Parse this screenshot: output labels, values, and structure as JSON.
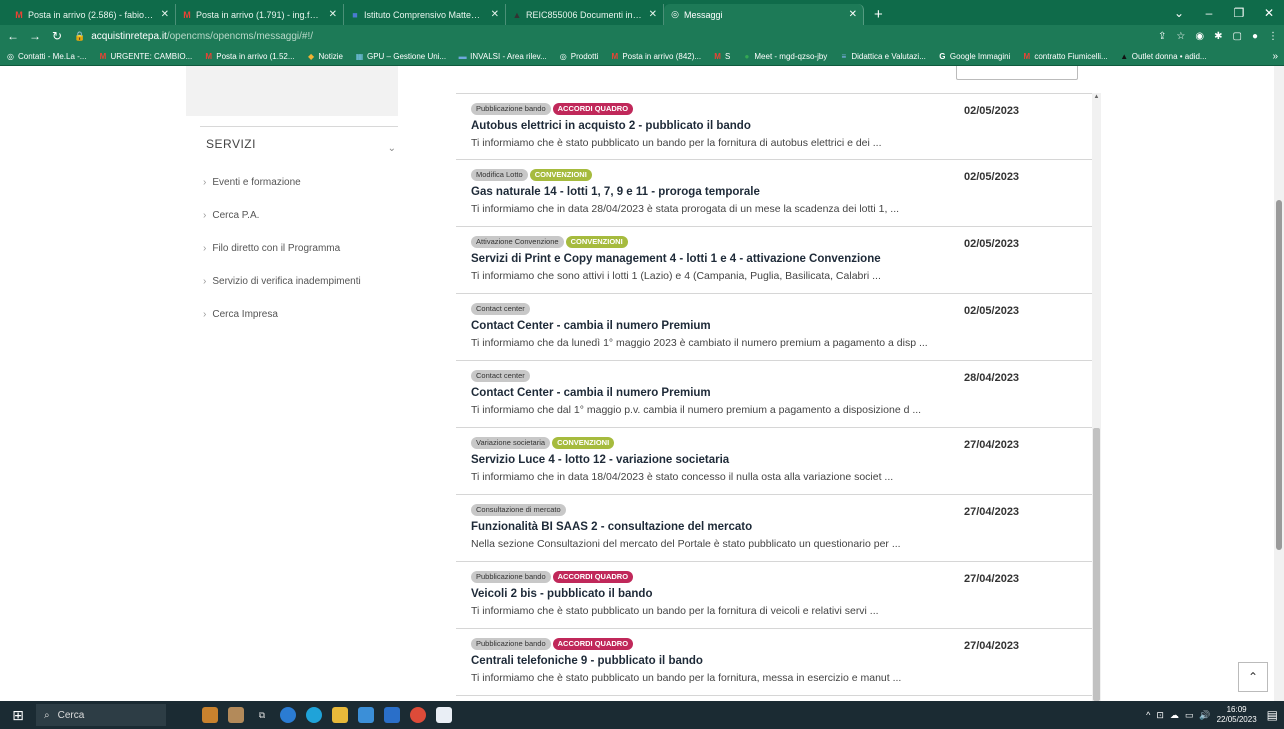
{
  "browser": {
    "tabs": [
      {
        "title": "Posta in arrivo (2.586) - fabio.ber",
        "icon": "gmail-icon",
        "active": false
      },
      {
        "title": "Posta in arrivo (1.791) - ing.fabio.",
        "icon": "gmail-icon",
        "active": false
      },
      {
        "title": "Istituto Comprensivo Matteo Ma",
        "icon": "school-icon",
        "active": false
      },
      {
        "title": "REIC855006 Documenti in DA Sh",
        "icon": "drive-icon",
        "active": false
      },
      {
        "title": "Messaggi",
        "icon": "site-icon",
        "active": true
      }
    ],
    "new_tab": "+",
    "url_host": "acquistinretepa.it",
    "url_path": "/opencms/opencms/messaggi/#!/",
    "bookmarks": [
      "Contatti - Me.La -...",
      "URGENTE: CAMBIO...",
      "Posta in arrivo (1.52...",
      "Notizie",
      "GPU – Gestione Uni...",
      "INVALSI - Area rilev...",
      "Prodotti",
      "Posta in arrivo (842)...",
      "S",
      "Meet - mgd-qzso-jby",
      "Didattica e Valutazi...",
      "Google Immagini",
      "contratto Fiumicelli...",
      "Outlet donna • adid..."
    ],
    "bookmarks_more": "»"
  },
  "sidebar": {
    "heading": "SERVIZI",
    "items": [
      "Eventi e formazione",
      "Cerca P.A.",
      "Filo diretto con il Programma",
      "Servizio di verifica inadempimenti",
      "Cerca Impresa"
    ]
  },
  "news": [
    {
      "tag": "Pubblicazione bando",
      "badge": "ACCORDI QUADRO",
      "badge_type": "acc",
      "date": "02/05/2023",
      "title": "Autobus elettrici in acquisto 2 - pubblicato il bando",
      "desc": "Ti informiamo che è stato pubblicato un bando per la fornitura di autobus elettrici e dei ..."
    },
    {
      "tag": "Modifica Lotto",
      "badge": "CONVENZIONI",
      "badge_type": "conv",
      "date": "02/05/2023",
      "title": "Gas naturale 14 - lotti 1, 7, 9 e 11 - proroga temporale",
      "desc": "Ti informiamo che in data 28/04/2023 è stata prorogata di un mese la scadenza dei lotti 1, ..."
    },
    {
      "tag": "Attivazione Convenzione",
      "badge": "CONVENZIONI",
      "badge_type": "conv",
      "date": "02/05/2023",
      "title": "Servizi di Print e Copy management 4 - lotti 1 e 4 - attivazione Convenzione",
      "desc": "Ti informiamo che sono attivi i lotti 1 (Lazio) e 4 (Campania, Puglia, Basilicata, Calabri ..."
    },
    {
      "tag": "Contact center",
      "badge": "",
      "badge_type": "",
      "date": "02/05/2023",
      "title": "Contact Center - cambia il numero Premium",
      "desc": "Ti informiamo che da lunedì 1° maggio 2023 è cambiato il numero premium a pagamento a disp ..."
    },
    {
      "tag": "Contact center",
      "badge": "",
      "badge_type": "",
      "date": "28/04/2023",
      "title": "Contact Center - cambia il numero Premium",
      "desc": "Ti informiamo che dal 1° maggio p.v. cambia il numero premium a pagamento a disposizione d ..."
    },
    {
      "tag": "Variazione societaria",
      "badge": "CONVENZIONI",
      "badge_type": "conv",
      "date": "27/04/2023",
      "title": "Servizio Luce 4 - lotto 12 - variazione societaria",
      "desc": "Ti informiamo che in data 18/04/2023 è stato concesso il nulla osta alla variazione societ ..."
    },
    {
      "tag": "Consultazione di mercato",
      "badge": "",
      "badge_type": "",
      "date": "27/04/2023",
      "title": "Funzionalità BI SAAS 2 - consultazione del mercato",
      "desc": "Nella sezione Consultazioni del mercato del Portale è stato pubblicato un questionario per ..."
    },
    {
      "tag": "Pubblicazione bando",
      "badge": "ACCORDI QUADRO",
      "badge_type": "acc",
      "date": "27/04/2023",
      "title": "Veicoli 2 bis - pubblicato il bando",
      "desc": "Ti informiamo che è stato pubblicato un bando per la fornitura di veicoli e relativi servi ..."
    },
    {
      "tag": "Pubblicazione bando",
      "badge": "ACCORDI QUADRO",
      "badge_type": "acc",
      "date": "27/04/2023",
      "title": "Centrali telefoniche 9 - pubblicato il bando",
      "desc": "Ti informiamo che è stato pubblicato un bando per la fornitura, messa in esercizio e manut ..."
    }
  ],
  "taskbar": {
    "search_label": "Cerca",
    "time": "16:09",
    "date": "22/05/2023"
  }
}
